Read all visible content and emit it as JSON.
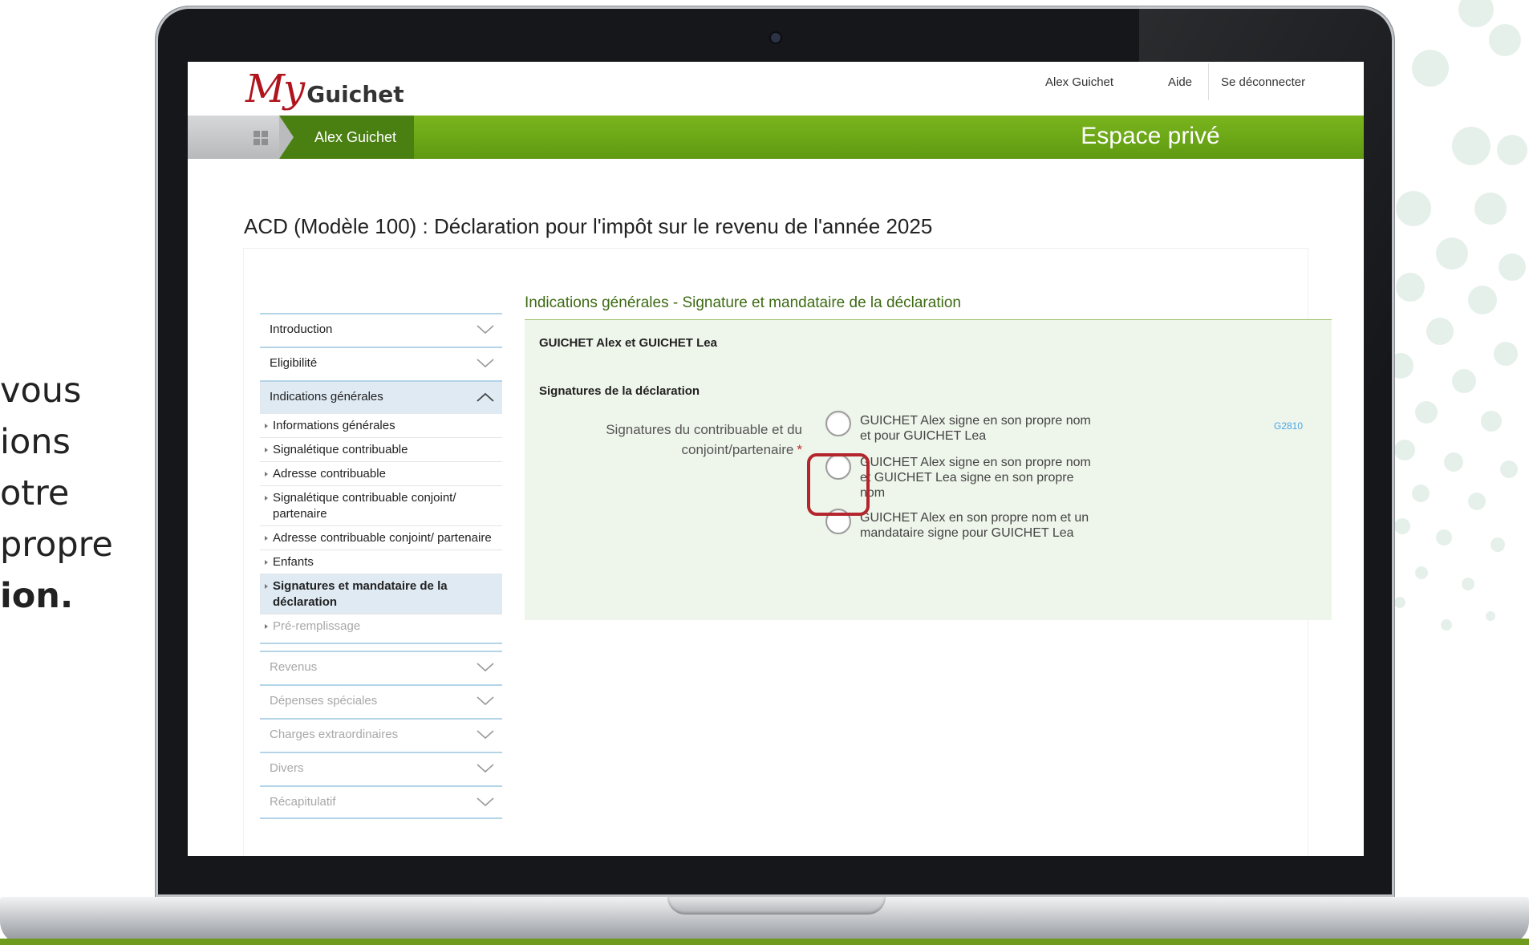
{
  "side_text": {
    "line1": "vous",
    "line2": "ions",
    "line3": "otre",
    "line4": "propre",
    "line5": "ion."
  },
  "header": {
    "logo_my": "My",
    "logo_guichet": "Guichet",
    "user_link": "Alex Guichet",
    "help_link": "Aide",
    "logout_link": "Se déconnecter"
  },
  "banner": {
    "user_name": "Alex Guichet",
    "title": "Espace privé"
  },
  "page_title": "ACD (Modèle 100) : Déclaration pour l'impôt sur le revenu de l'année 2025",
  "sidebar": {
    "introduction": "Introduction",
    "eligibilite": "Eligibilité",
    "indications": "Indications générales",
    "sub_items": [
      "Informations générales",
      "Signalétique contribuable",
      "Adresse contribuable",
      "Signalétique contribuable conjoint/ partenaire",
      "Adresse contribuable conjoint/ partenaire",
      "Enfants",
      "Signatures et mandataire de la déclaration",
      "Pré-remplissage"
    ],
    "revenus": "Revenus",
    "depenses": "Dépenses spéciales",
    "charges": "Charges extraordinaires",
    "divers": "Divers",
    "recapitulatif": "Récapitulatif"
  },
  "form": {
    "section_title": "Indications générales - Signature et mandataire de la déclaration",
    "taxpayers": "GUICHET Alex et GUICHET Lea",
    "signatures_heading": "Signatures de la déclaration",
    "field_label": "Signatures du contribuable et du conjoint/partenaire",
    "required_mark": "*",
    "field_code": "G2810",
    "options": [
      "GUICHET Alex signe en son propre nom et pour GUICHET Lea",
      "GUICHET Alex signe en son propre nom et GUICHET Lea signe en son propre nom",
      "GUICHET Alex en son propre nom et un mandataire signe pour GUICHET Lea"
    ]
  },
  "colors": {
    "brand_green": "#6eaa18",
    "logo_red": "#b0151e",
    "highlight_red": "#b3262d",
    "sidebar_blue": "#dfeaf3"
  }
}
